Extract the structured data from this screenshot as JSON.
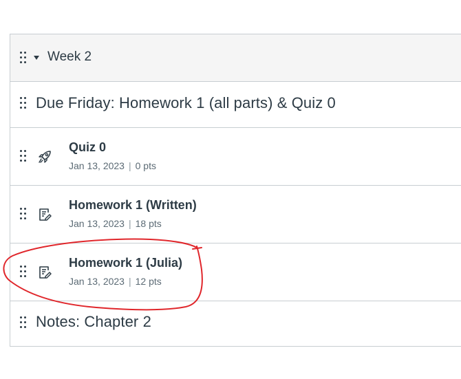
{
  "module": {
    "title": "Week 2",
    "items": [
      {
        "kind": "subheader",
        "title": "Due Friday: Homework 1 (all parts) & Quiz 0"
      },
      {
        "kind": "quiz",
        "icon": "rocket-icon",
        "title": "Quiz 0",
        "date": "Jan 13, 2023",
        "separator": "|",
        "points": "0 pts"
      },
      {
        "kind": "assignment",
        "icon": "assignment-icon",
        "title": "Homework 1 (Written)",
        "date": "Jan 13, 2023",
        "separator": "|",
        "points": "18 pts"
      },
      {
        "kind": "assignment",
        "icon": "assignment-icon",
        "title": "Homework 1 (Julia)",
        "date": "Jan 13, 2023",
        "separator": "|",
        "points": "12 pts"
      },
      {
        "kind": "subheader",
        "title": "Notes: Chapter 2"
      }
    ]
  },
  "annotation": {
    "color": "#e0262b",
    "marks": "red-circle-around-homework-1-julia"
  }
}
